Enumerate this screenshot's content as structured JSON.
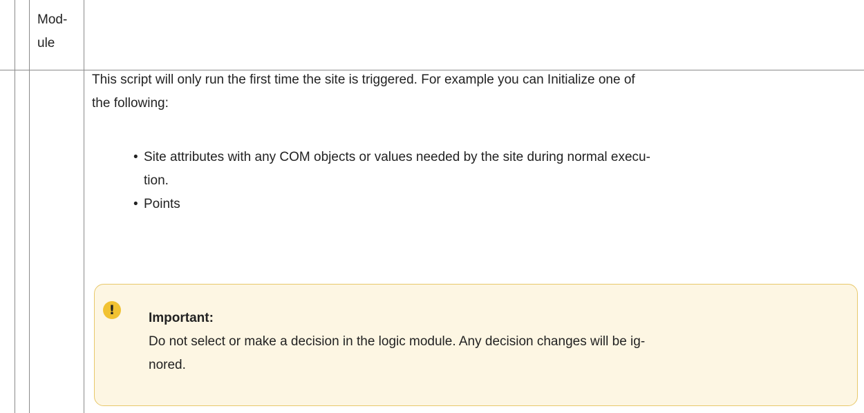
{
  "module_cell": {
    "line1": "Mod-",
    "line2": "ule"
  },
  "description": {
    "intro_line1": "This script will only run the first time the site is triggered. For example you can Initialize one of",
    "intro_line2": "the following:",
    "bullets": [
      {
        "line1": "Site attributes with any COM objects or values needed by the site during normal execu-",
        "line2": "tion."
      },
      {
        "line1": "Points"
      }
    ]
  },
  "note": {
    "icon": "exclamation-icon",
    "icon_glyph": "!",
    "title": "Important:",
    "body_line1": "Do not select or make a decision in the logic module. Any decision changes will be ig-",
    "body_line2": "nored."
  },
  "colors": {
    "table_border": "#8a8a8a",
    "note_background": "#fdf6e3",
    "note_border": "#e8c86a",
    "note_icon": "#f1c232"
  }
}
